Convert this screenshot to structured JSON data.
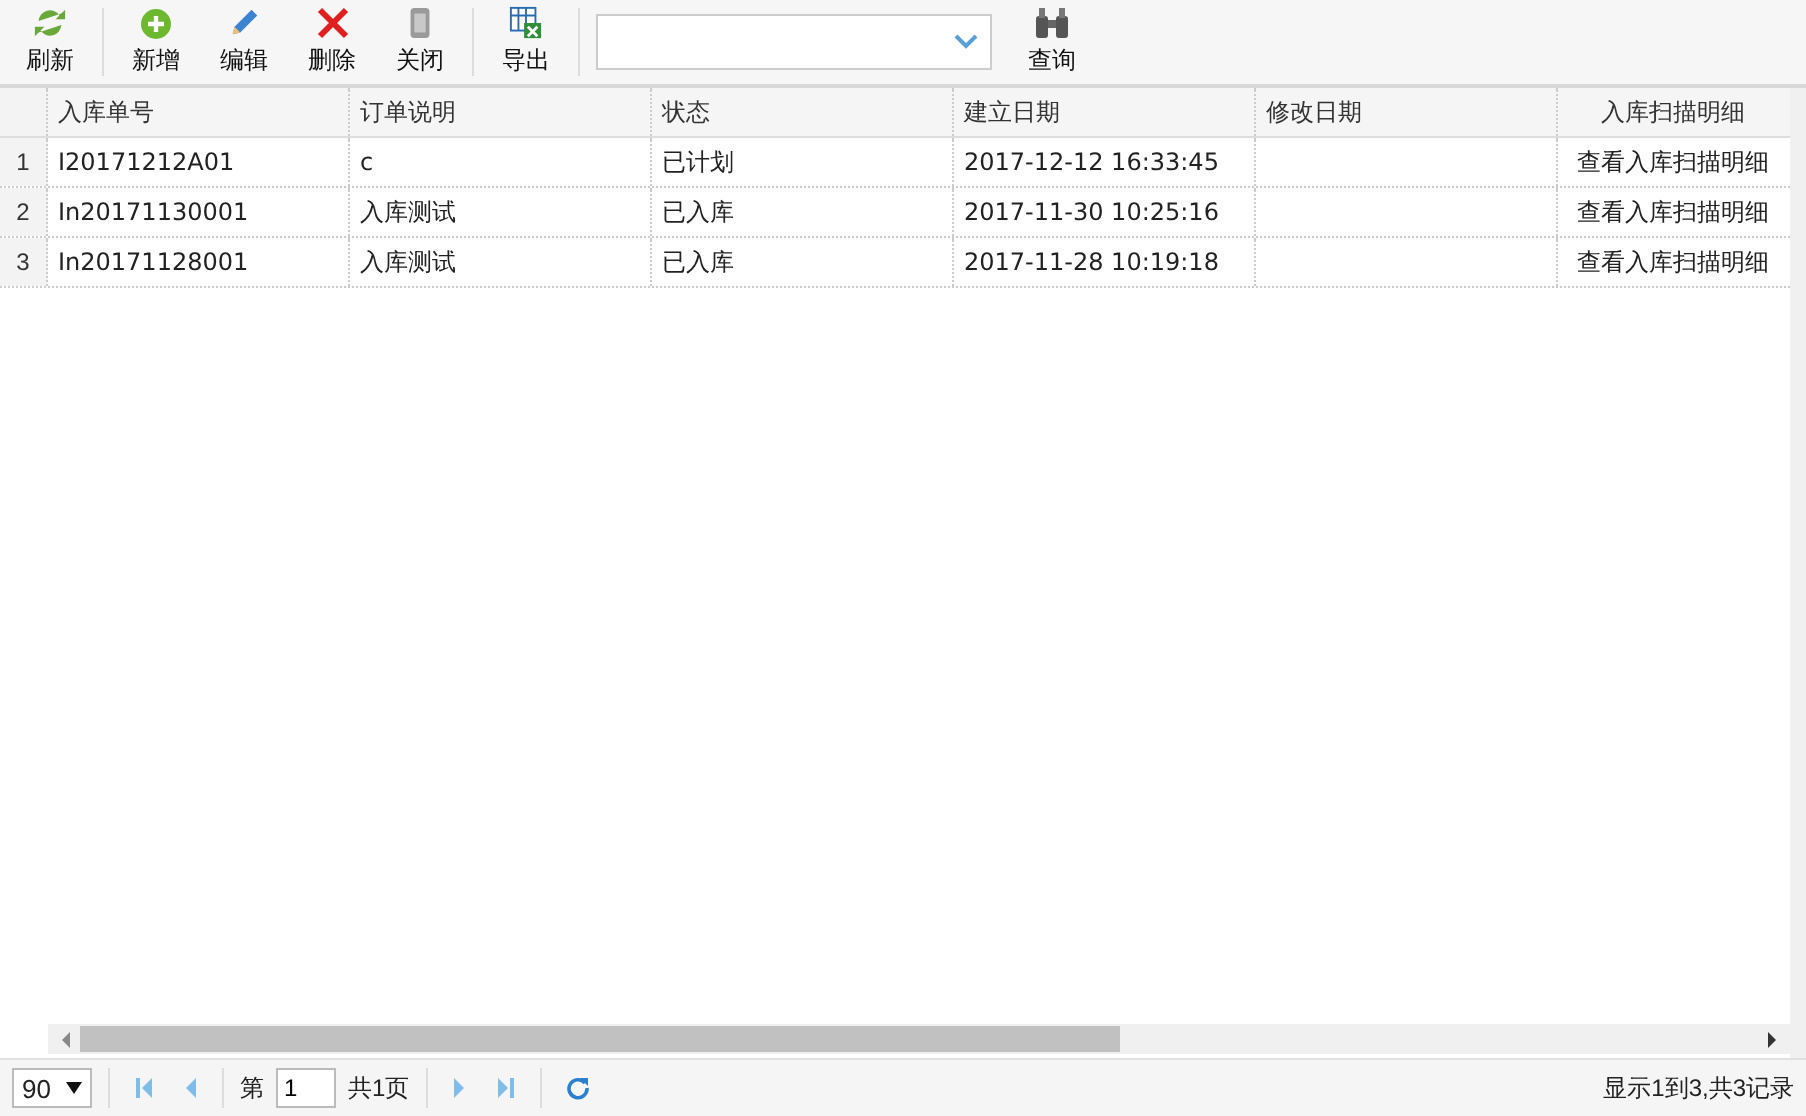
{
  "toolbar": [
    [
      {
        "kind": "refresh",
        "label": "刷新"
      }
    ],
    [
      {
        "kind": "add",
        "label": "新增"
      },
      {
        "kind": "edit",
        "label": "编辑"
      },
      {
        "kind": "delete",
        "label": "删除"
      },
      {
        "kind": "close",
        "label": "关闭"
      }
    ],
    [
      {
        "kind": "export",
        "label": "导出"
      }
    ],
    [
      {
        "kind": "combo"
      },
      {
        "kind": "search",
        "label": "查询"
      }
    ]
  ],
  "table": {
    "columns": [
      "入库单号",
      "订单说明",
      "状态",
      "建立日期",
      "修改日期",
      "入库扫描明细"
    ],
    "rows": [
      {
        "number": "1",
        "cells": [
          "I20171212A01",
          "c",
          "已计划",
          "2017-12-12 16:33:45",
          "",
          "查看入库扫描明细"
        ]
      },
      {
        "number": "2",
        "cells": [
          "In20171130001",
          "入库测试",
          "已入库",
          "2017-11-30 10:25:16",
          "",
          "查看入库扫描明细"
        ]
      },
      {
        "number": "3",
        "cells": [
          "In20171128001",
          "入库测试",
          "已入库",
          "2017-11-28 10:19:18",
          "",
          "查看入库扫描明细"
        ]
      }
    ]
  },
  "pager": {
    "page_size": "90",
    "page_prefix": "第",
    "page": "1",
    "page_total": "共1页",
    "summary": "显示1到3,共3记录"
  }
}
